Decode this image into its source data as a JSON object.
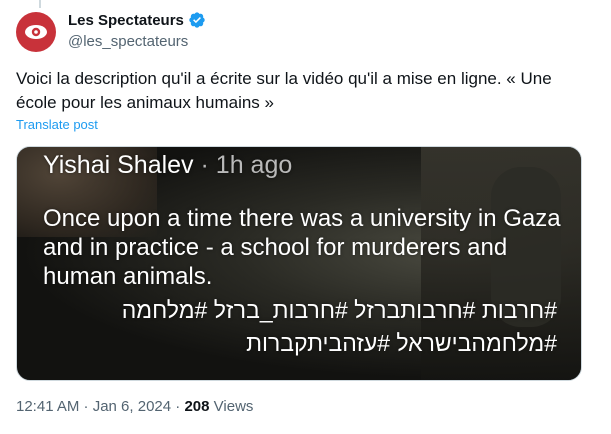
{
  "author": {
    "display_name": "Les Spectateurs",
    "handle": "@les_spectateurs",
    "avatar": "eye-logo-icon",
    "verified_icon": "verified-badge-icon",
    "brand_color": "#c8323a",
    "verified_color": "#1d9bf0"
  },
  "tweet": {
    "text": "Voici la description qu'il a écrite sur la vidéo qu'il a mise en ligne. « Une école pour les animaux humains »",
    "translate_label": "Translate post"
  },
  "media": {
    "author": "Yishai Shalev",
    "time": "· 1h ago",
    "body": "Once upon a time there was a university in Gaza and in practice - a school for murderers and human animals.",
    "hashtags_line1": "#חרבות #חרבותברזל #חרבות_ברזל #מלחמה",
    "hashtags_line2": "#מלחמהבישראל #עזהביתקברות"
  },
  "meta": {
    "timestamp": "12:41 AM · Jan 6, 2024 ·",
    "views_count": "208",
    "views_label": "Views"
  }
}
